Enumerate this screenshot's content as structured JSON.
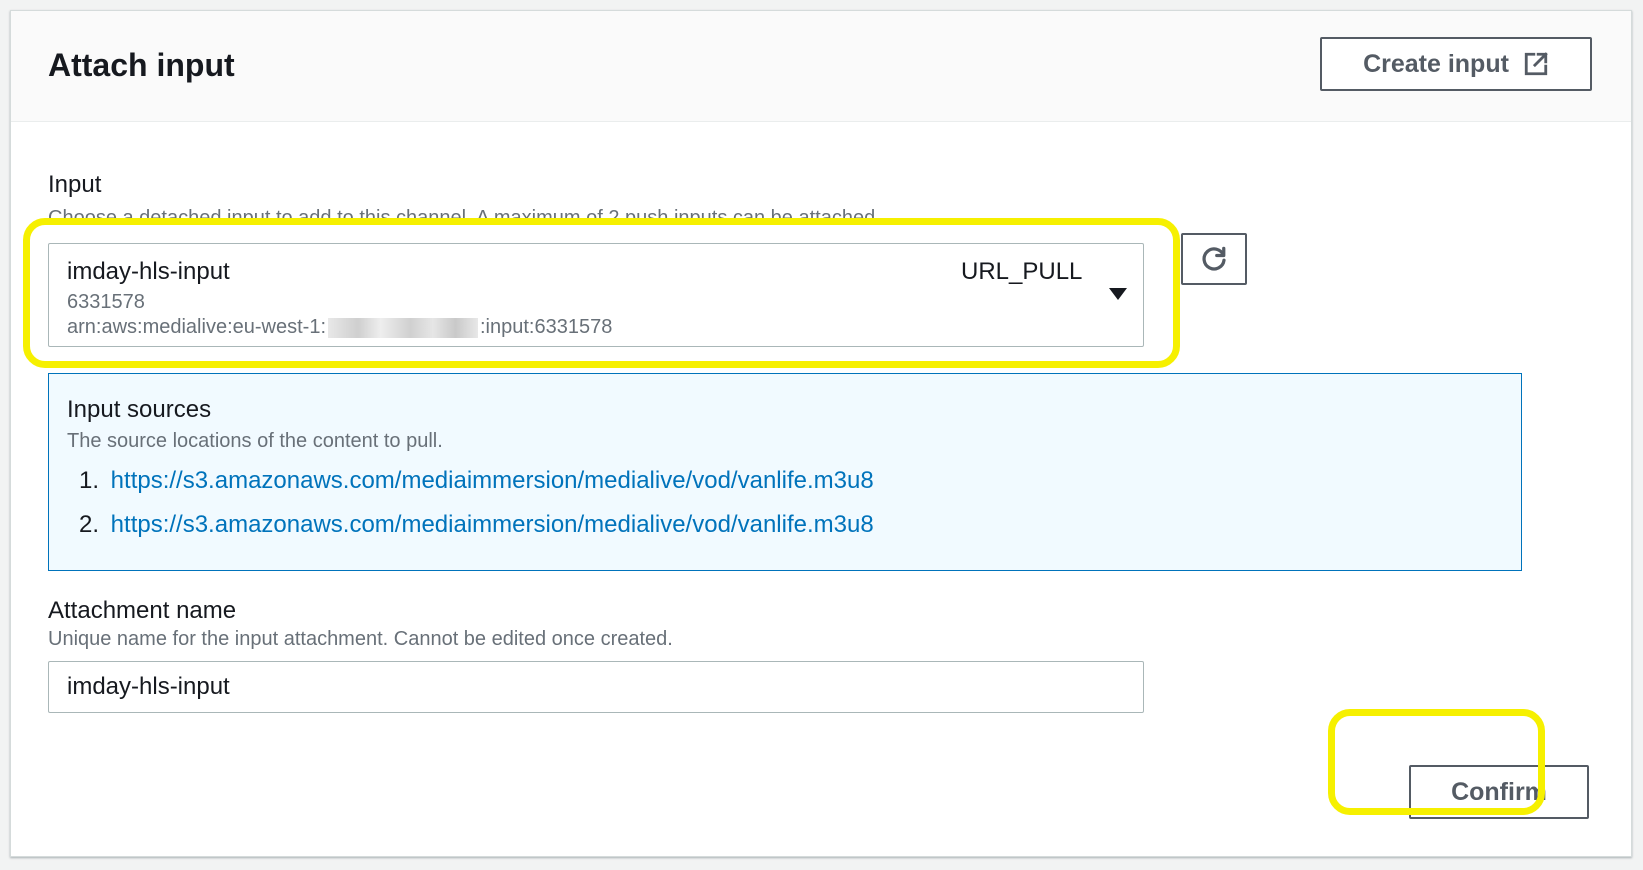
{
  "panel": {
    "title": "Attach input",
    "create_button": "Create input"
  },
  "input_field": {
    "label": "Input",
    "description": "Choose a detached input to add to this channel. A maximum of 2 push inputs can be attached.",
    "selected": {
      "name": "imday-hls-input",
      "id": "6331578",
      "arn_prefix": "arn:aws:medialive:eu-west-1:",
      "arn_suffix": ":input:6331578",
      "type": "URL_PULL"
    }
  },
  "input_sources": {
    "title": "Input sources",
    "description": "The source locations of the content to pull.",
    "items": [
      {
        "num": "1.",
        "url": "https://s3.amazonaws.com/mediaimmersion/medialive/vod/vanlife.m3u8"
      },
      {
        "num": "2.",
        "url": "https://s3.amazonaws.com/mediaimmersion/medialive/vod/vanlife.m3u8"
      }
    ]
  },
  "attachment": {
    "label": "Attachment name",
    "description": "Unique name for the input attachment. Cannot be edited once created.",
    "value": "imday-hls-input"
  },
  "actions": {
    "confirm": "Confirm"
  },
  "colors": {
    "highlight": "#f6f000",
    "link": "#0073bb",
    "info_bg": "#f1faff"
  },
  "icons": {
    "create_button": "external-link-icon",
    "refresh": "refresh-icon",
    "select": "caret-down-icon"
  }
}
